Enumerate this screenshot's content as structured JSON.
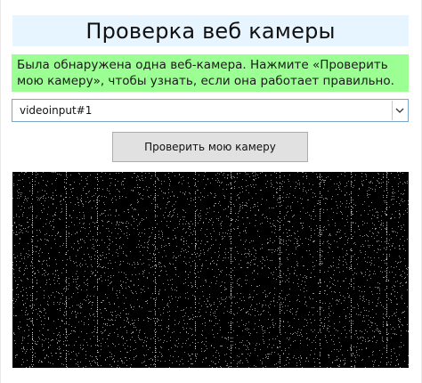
{
  "page": {
    "title": "Проверка веб камеры",
    "message": "Была обнаружена одна веб-камера. Нажмите «Проверить мою камеру», чтобы узнать, если она работает правильно."
  },
  "device_select": {
    "selected": "videoinput#1",
    "icon": "chevron-down-icon"
  },
  "check_button": {
    "label": "Проверить мою камеру"
  },
  "video": {
    "state": "static-noise",
    "colors": {
      "background": "#000000",
      "noise": "#ffffff"
    }
  },
  "colors": {
    "title_background": "#e6f5ff",
    "message_background": "#9cff93",
    "button_background": "#e1e1e1",
    "select_border": "#7aa7c7"
  }
}
